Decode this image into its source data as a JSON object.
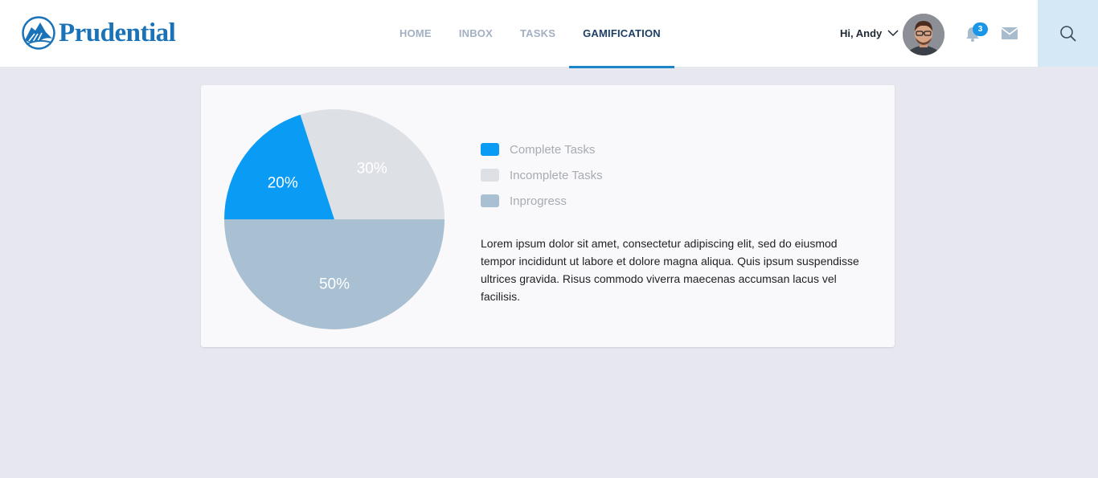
{
  "header": {
    "brand": "Prudential",
    "nav": [
      {
        "label": "HOME",
        "active": false
      },
      {
        "label": "INBOX",
        "active": false
      },
      {
        "label": "TASKS",
        "active": false
      },
      {
        "label": "GAMIFICATION",
        "active": true
      }
    ],
    "greeting": "Hi, Andy",
    "notification_count": "3",
    "icons": {
      "logo": "prudential-rock-logo-icon",
      "dropdown": "chevron-down-icon",
      "notifications": "bell-icon",
      "messages": "envelope-icon",
      "search": "search-icon"
    },
    "colors": {
      "brand": "#1a73b8",
      "nav_active": "#1d3f66",
      "nav_inactive": "#a2b0c2",
      "active_underline": "#1a86c9",
      "badge": "#1a96e8",
      "search_bg": "#d5e8f5"
    }
  },
  "card": {
    "legend": [
      {
        "label": "Complete Tasks",
        "color": "#0a9cf5"
      },
      {
        "label": "Incomplete Tasks",
        "color": "#dde0e5"
      },
      {
        "label": "Inprogress",
        "color": "#a9c0d3"
      }
    ],
    "description": "Lorem ipsum dolor sit amet, consectetur adipiscing elit, sed do eiusmod tempor incididunt ut labore et dolore magna aliqua. Quis ipsum suspendisse ultrices gravida. Risus commodo viverra maecenas accumsan lacus vel facilisis."
  },
  "chart_data": {
    "type": "pie",
    "categories": [
      "Complete Tasks",
      "Incomplete Tasks",
      "Inprogress"
    ],
    "values": [
      20,
      30,
      50
    ],
    "labels": [
      "20%",
      "30%",
      "50%"
    ],
    "colors": [
      "#0a9cf5",
      "#dde0e5",
      "#a9c0d3"
    ],
    "label_colors": [
      "#ffffff",
      "#ffffff",
      "#ffffff"
    ],
    "legend_position": "right"
  }
}
